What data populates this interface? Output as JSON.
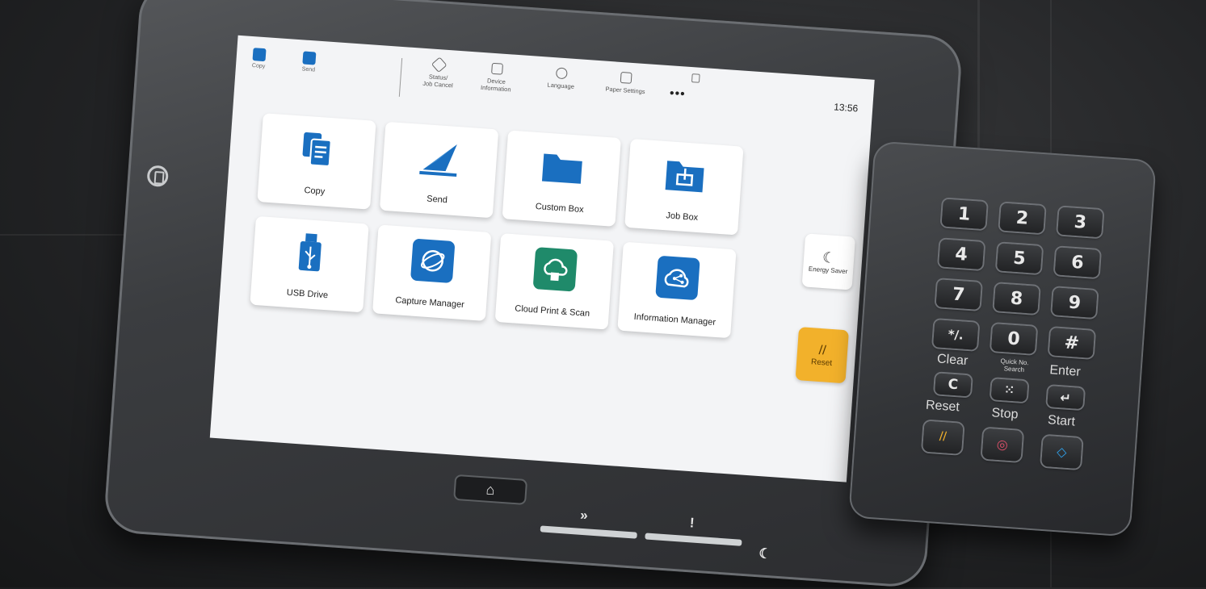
{
  "topbar": {
    "mini_apps": [
      {
        "label": "Copy",
        "icon": "copy-icon"
      },
      {
        "label": "Send",
        "icon": "send-icon"
      }
    ],
    "tools": [
      {
        "label": "Status/\nJob Cancel",
        "icon": "status-icon"
      },
      {
        "label": "Device\nInformation",
        "icon": "device-info-icon"
      },
      {
        "label": "Language",
        "icon": "language-icon"
      },
      {
        "label": "Paper Settings",
        "icon": "paper-settings-icon"
      }
    ],
    "more": "•••",
    "time": "13:56"
  },
  "apps": [
    {
      "label": "Copy",
      "icon": "copy-icon"
    },
    {
      "label": "Send",
      "icon": "send-icon"
    },
    {
      "label": "Custom Box",
      "icon": "folder-icon"
    },
    {
      "label": "Job Box",
      "icon": "job-box-icon"
    },
    {
      "label": "USB Drive",
      "icon": "usb-icon"
    },
    {
      "label": "Capture Manager",
      "icon": "capture-manager-icon"
    },
    {
      "label": "Cloud Print & Scan",
      "icon": "cloud-icon"
    },
    {
      "label": "Information Manager",
      "icon": "information-manager-icon"
    }
  ],
  "side": {
    "energy_saver": "Energy Saver",
    "reset": "Reset"
  },
  "keypad": {
    "digits": [
      "1",
      "2",
      "3",
      "4",
      "5",
      "6",
      "7",
      "8",
      "9",
      "*/.",
      "0",
      "#"
    ],
    "clear_label": "Clear",
    "quick_label": "Quick No.\nSearch",
    "enter_label": "Enter",
    "clear_key": "C",
    "reset_label": "Reset",
    "stop_label": "Stop",
    "start_label": "Start"
  },
  "colors": {
    "blue": "#1a6fc0",
    "green": "#1f8a6a",
    "reset_yellow": "#f2b12b",
    "stop_red": "#e0506a",
    "start_blue": "#2f9ee6"
  }
}
